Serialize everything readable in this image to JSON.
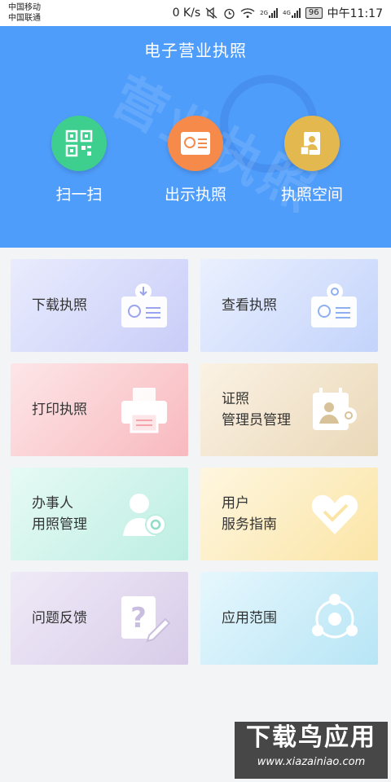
{
  "status": {
    "carrier1": "中国移动",
    "carrier2": "中国联通",
    "speed": "0 K/s",
    "net1": "2G",
    "net2": "4G",
    "battery": "96",
    "time": "中午11:17"
  },
  "header": {
    "title": "电子营业执照",
    "watermark": "营业执照",
    "background": "#4f9dfb"
  },
  "quick_actions": [
    {
      "label": "扫一扫",
      "icon": "qr-code-icon",
      "color": "#3ecf8e"
    },
    {
      "label": "出示执照",
      "icon": "license-card-icon",
      "color": "#f58a4a"
    },
    {
      "label": "执照空间",
      "icon": "license-space-icon",
      "color": "#e3b84f"
    }
  ],
  "cards": [
    {
      "line1": "下载执照",
      "line2": "",
      "icon": "download-license-icon"
    },
    {
      "line1": "查看执照",
      "line2": "",
      "icon": "view-license-icon"
    },
    {
      "line1": "打印执照",
      "line2": "",
      "icon": "printer-icon"
    },
    {
      "line1": "证照",
      "line2": "管理员管理",
      "icon": "admin-management-icon"
    },
    {
      "line1": "办事人",
      "line2": "用照管理",
      "icon": "agent-settings-icon"
    },
    {
      "line1": "用户",
      "line2": "服务指南",
      "icon": "heart-guide-icon"
    },
    {
      "line1": "问题反馈",
      "line2": "",
      "icon": "feedback-question-icon"
    },
    {
      "line1": "应用范围",
      "line2": "",
      "icon": "scope-share-icon"
    }
  ],
  "site_watermark": {
    "title": "下载鸟应用",
    "url": "www.xiazainiao.com"
  }
}
